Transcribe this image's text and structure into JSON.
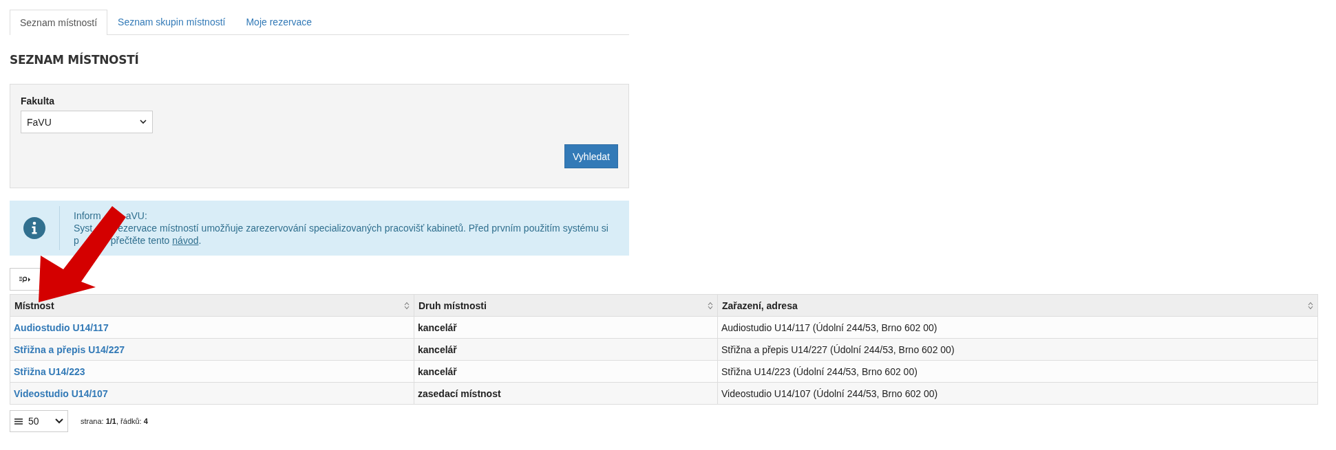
{
  "tabs": [
    {
      "label": "Seznam místností",
      "selected": true
    },
    {
      "label": "Seznam skupin místností",
      "selected": false
    },
    {
      "label": "Moje rezervace",
      "selected": false
    }
  ],
  "heading": "SEZNAM MÍSTNOSTÍ",
  "filter": {
    "label": "Fakulta",
    "value": "FaVU",
    "button": "Vyhledat"
  },
  "info": {
    "lines": [
      {
        "start": "Inform",
        "rest": "aVU:"
      },
      {
        "start": "Syst",
        "rest": "ezervace místností umožňuje zarezervování specializovaných pracovišť kabinetů. Před prvním použitím systému si"
      },
      {
        "start": "p",
        "rest": "přečtěte tento ",
        "link": "návod",
        "after": "."
      }
    ]
  },
  "table": {
    "columns": [
      {
        "label": "Místnost"
      },
      {
        "label": "Druh místnosti"
      },
      {
        "label": "Zařazení, adresa"
      }
    ],
    "rows": [
      [
        "Audiostudio U14/117",
        "kancelář",
        "Audiostudio U14/117 (Údolní 244/53, Brno 602 00)"
      ],
      [
        "Střižna a přepis U14/227",
        "kancelář",
        "Střižna a přepis U14/227 (Údolní 244/53, Brno 602 00)"
      ],
      [
        "Střižna U14/223",
        "kancelář",
        "Střižna U14/223 (Údolní 244/53, Brno 602 00)"
      ],
      [
        "Videostudio U14/107",
        "zasedací místnost",
        "Videostudio U14/107 (Údolní 244/53, Brno 602 00)"
      ]
    ]
  },
  "pager": {
    "page_size": "50",
    "summary": "strana: **1/1**, řádků: **4**"
  }
}
